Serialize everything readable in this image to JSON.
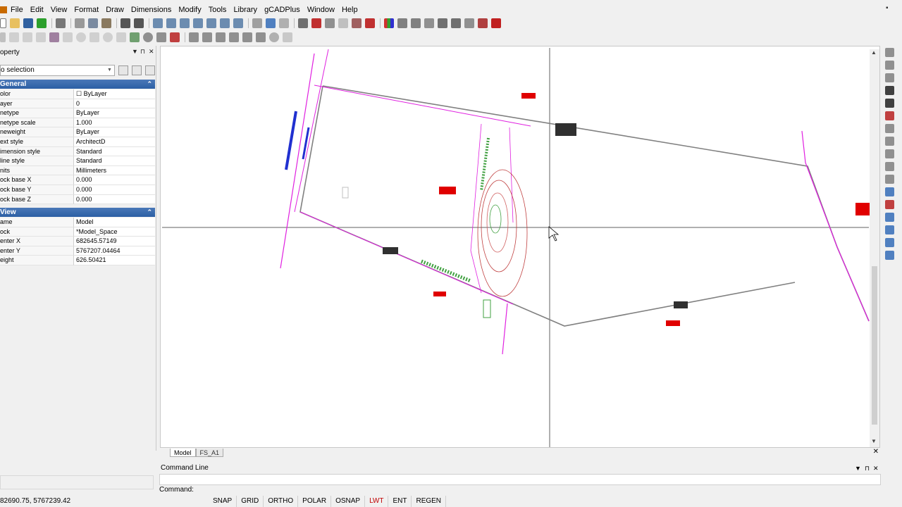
{
  "menu": [
    "File",
    "Edit",
    "View",
    "Format",
    "Draw",
    "Dimensions",
    "Modify",
    "Tools",
    "Library",
    "gCADPlus",
    "Window",
    "Help"
  ],
  "property_panel": {
    "title": "operty",
    "selection": "o selection",
    "sections": [
      {
        "name": "General",
        "rows": [
          {
            "key": "olor",
            "value": "☐ ByLayer"
          },
          {
            "key": "ayer",
            "value": "0"
          },
          {
            "key": "netype",
            "value": "ByLayer"
          },
          {
            "key": "netype scale",
            "value": "1.000"
          },
          {
            "key": "neweight",
            "value": "ByLayer"
          },
          {
            "key": "ext style",
            "value": "ArchitectD"
          },
          {
            "key": "imension style",
            "value": "Standard"
          },
          {
            "key": "line style",
            "value": "Standard"
          },
          {
            "key": "nits",
            "value": "Millimeters"
          },
          {
            "key": "ock base X",
            "value": "0.000"
          },
          {
            "key": "ock base Y",
            "value": "0.000"
          },
          {
            "key": "ock base Z",
            "value": "0.000"
          }
        ]
      },
      {
        "name": "View",
        "rows": [
          {
            "key": "ame",
            "value": "Model"
          },
          {
            "key": "ock",
            "value": "*Model_Space"
          },
          {
            "key": "enter X",
            "value": "682645.57149"
          },
          {
            "key": "enter Y",
            "value": "5767207.04464"
          },
          {
            "key": "eight",
            "value": "626.50421"
          }
        ]
      }
    ]
  },
  "layout_tabs": [
    "Model",
    "FS_A1"
  ],
  "command_line": {
    "title": "Command Line",
    "prompt": "Command:"
  },
  "status": {
    "coords": "82690.75, 5767239.42",
    "buttons": [
      {
        "label": "SNAP",
        "on": false
      },
      {
        "label": "GRID",
        "on": false
      },
      {
        "label": "ORTHO",
        "on": false
      },
      {
        "label": "POLAR",
        "on": false
      },
      {
        "label": "OSNAP",
        "on": false
      },
      {
        "label": "LWT",
        "on": true
      },
      {
        "label": "ENT",
        "on": false
      },
      {
        "label": "REGEN",
        "on": false
      }
    ]
  },
  "colors": {
    "section_header": "#2c5fa4",
    "boundary": "#808080",
    "road_magenta": "#e020e0",
    "markers_red": "#e00000",
    "contour": "#c04040",
    "lwt_on": "#c00000"
  }
}
